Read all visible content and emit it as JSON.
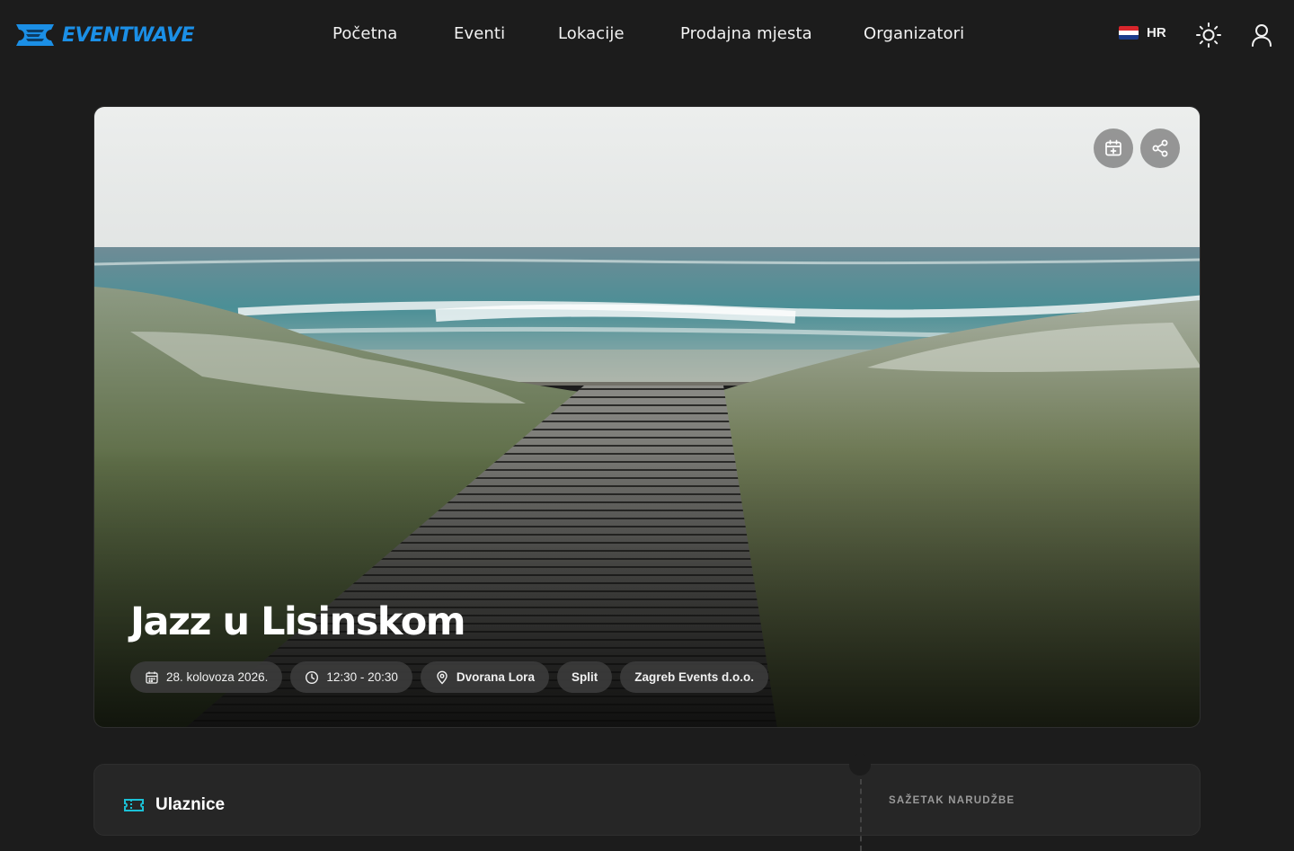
{
  "brand": {
    "name": "EVENTWAVE",
    "color": "#1b8fe6"
  },
  "nav": {
    "items": [
      {
        "label": "Početna"
      },
      {
        "label": "Eventi"
      },
      {
        "label": "Lokacije"
      },
      {
        "label": "Prodajna mjesta"
      },
      {
        "label": "Organizatori"
      }
    ]
  },
  "header": {
    "language": "HR",
    "icons": [
      "croatia-flag-icon",
      "sun-icon",
      "user-icon"
    ]
  },
  "event": {
    "title": "Jazz u Lisinskom",
    "date": "28. kolovoza 2026.",
    "time": "12:30 - 20:30",
    "venue": "Dvorana Lora",
    "city": "Split",
    "organizer": "Zagreb Events d.o.o.",
    "actions": [
      "calendar-add-icon",
      "share-icon"
    ]
  },
  "tickets": {
    "heading": "Ulaznice",
    "icon": "ticket-icon"
  },
  "summary": {
    "heading": "SAŽETAK NARUDŽBE"
  },
  "colors": {
    "background": "#1c1c1c",
    "panel": "#262626",
    "accent": "#1b8fe6"
  }
}
